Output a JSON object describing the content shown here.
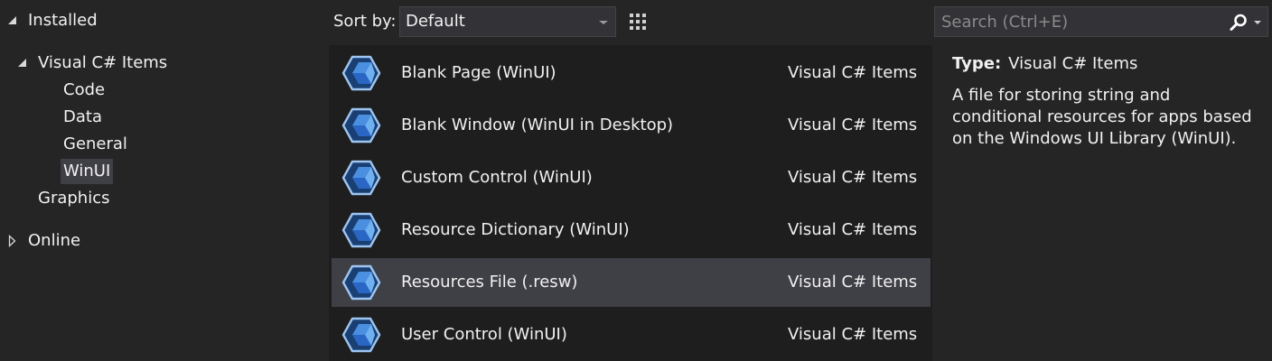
{
  "tree": {
    "installed": "Installed",
    "visual_csharp": "Visual C# Items",
    "children": [
      "Code",
      "Data",
      "General",
      "WinUI"
    ],
    "graphics": "Graphics",
    "online": "Online"
  },
  "toolbar": {
    "sort_label": "Sort by:",
    "sort_value": "Default"
  },
  "templates": [
    {
      "name": "Blank Page (WinUI)",
      "category": "Visual C# Items",
      "selected": false
    },
    {
      "name": "Blank Window (WinUI in Desktop)",
      "category": "Visual C# Items",
      "selected": false
    },
    {
      "name": "Custom Control (WinUI)",
      "category": "Visual C# Items",
      "selected": false
    },
    {
      "name": "Resource Dictionary (WinUI)",
      "category": "Visual C# Items",
      "selected": false
    },
    {
      "name": "Resources File (.resw)",
      "category": "Visual C# Items",
      "selected": true
    },
    {
      "name": "User Control (WinUI)",
      "category": "Visual C# Items",
      "selected": false
    }
  ],
  "search": {
    "placeholder": "Search (Ctrl+E)",
    "value": ""
  },
  "details": {
    "type_label": "Type:",
    "type_value": "Visual C# Items",
    "description": "A file for storing string and conditional resources for apps based on the Windows UI Library (WinUI)."
  },
  "colors": {
    "background": "#252526",
    "list_background": "#1e1e1e",
    "selection": "#3f3f46",
    "accent": "#3399ff",
    "icon_blue": "#3b82d6"
  }
}
